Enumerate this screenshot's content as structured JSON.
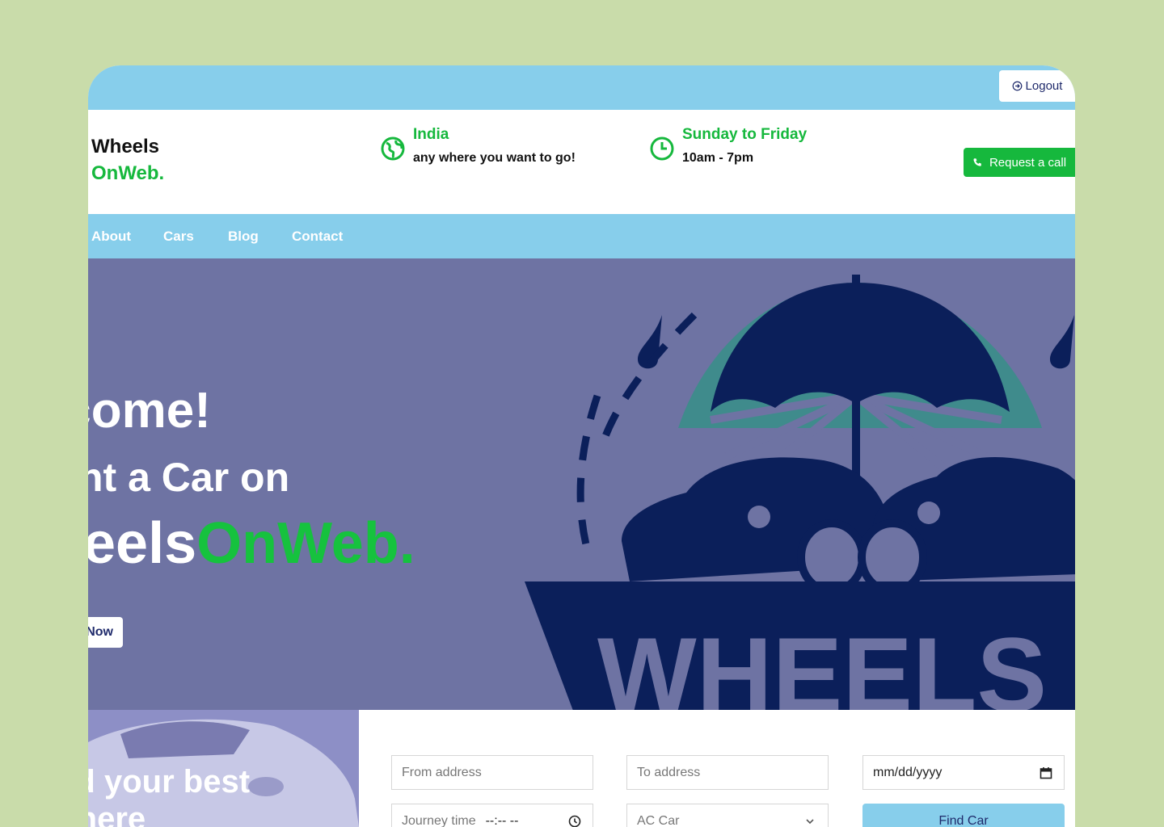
{
  "topbar": {
    "logout_label": "Logout"
  },
  "header": {
    "brand_line1": "Wheels",
    "brand_line2": "OnWeb.",
    "location_title": "India",
    "location_sub": "any where you want to go!",
    "hours_title": "Sunday to Friday",
    "hours_sub": "10am - 7pm",
    "request_call_label": "Request a call"
  },
  "nav": {
    "items": [
      "About",
      "Cars",
      "Blog",
      "Contact"
    ]
  },
  "hero": {
    "line1": "lcome!",
    "line2": "nt a Car on",
    "line3_white": "heels",
    "line3_green": "OnWeb.",
    "button_label": "Now",
    "logo_word": "WHEELS"
  },
  "search": {
    "image_text_line1": "nd your best",
    "image_text_line2": "r here",
    "from_placeholder": "From address",
    "to_placeholder": "To address",
    "date_placeholder": "mm/dd/yyyy",
    "journey_label": "Journey time",
    "journey_value": "--:-- --",
    "car_type_value": "AC Car",
    "find_button_label": "Find Car"
  },
  "colors": {
    "sky": "#87ceeb",
    "green": "#16b83d",
    "hero_bg": "#6e73a3",
    "navy": "#0b1f5a",
    "page_bg": "#c9dcaa"
  }
}
